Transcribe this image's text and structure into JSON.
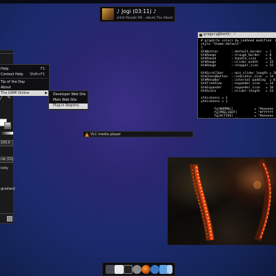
{
  "now_playing": {
    "title": "♪ Jogi (03:11) ♪",
    "subtitle": "artist  Panjabi MC  · album  The Album"
  },
  "gimp_dock": {
    "value_field": "100.0",
    "mode_label": "cle (11)",
    "opacity_label": "ivity",
    "gradient_label": "gradient"
  },
  "help_menu": {
    "items": [
      {
        "label": "Help",
        "accel": "F1"
      },
      {
        "label": "Context Help",
        "accel": "Shift+F1"
      },
      {
        "label": "Tip of the Day",
        "accel": ""
      },
      {
        "label": "About",
        "accel": ""
      },
      {
        "label": "The GIMP Online",
        "accel": ""
      }
    ],
    "submenu": [
      {
        "label": "Developer Web Site"
      },
      {
        "label": "Main Web Site"
      },
      {
        "label": "Plug-in Registry"
      }
    ]
  },
  "vlc": {
    "title": "VLC media player"
  },
  "terminal": {
    "title": "gregory@khoth: ~",
    "lines": [
      "# graphite colors by Lokheed modified  bv",
      "style \"theme-default\"",
      "{",
      "GtkButton       ::default_border  = {",
      "GtkRange        ::trough_border   = 0",
      "GtkPaned        ::handle_size     = 6",
      "GtkRange        ::slider_width    = 15",
      "GtkRange        ::stepper_size    = 15",
      "",
      "GtkScrollbar    ::min_slider_length = 30",
      "GtkCheckButton  ::indicator_size  = 14",
      "GtkMenuBar      ::internal-padding  = 0",
      "GtkTreeView     ::expander_size   = 14",
      "GtkExpander     ::expander_size   = 16",
      "GtkScale        ::slider-length   = 24",
      "",
      "xthickness = 1",
      "ythickness = 1",
      "",
      "       fg[NORMAL]           = \"#eeeeee",
      "       fg[PRELIGHT]         = \"#ffffff",
      "       fg[ACTIVE]           = \"#eeeeee",
      "bs, Active window list"
    ]
  },
  "taskbar": {
    "icons": [
      "file-manager-icon",
      "document-icon",
      "terminal-icon",
      "settings-icon",
      "firefox-icon",
      "network-icon",
      "chat-icon",
      "download-icon"
    ]
  },
  "colors": {
    "desktop_base": "#2b2670",
    "menu_highlight": "#d9d9d9",
    "vlc_orange": "#f08a1c"
  }
}
